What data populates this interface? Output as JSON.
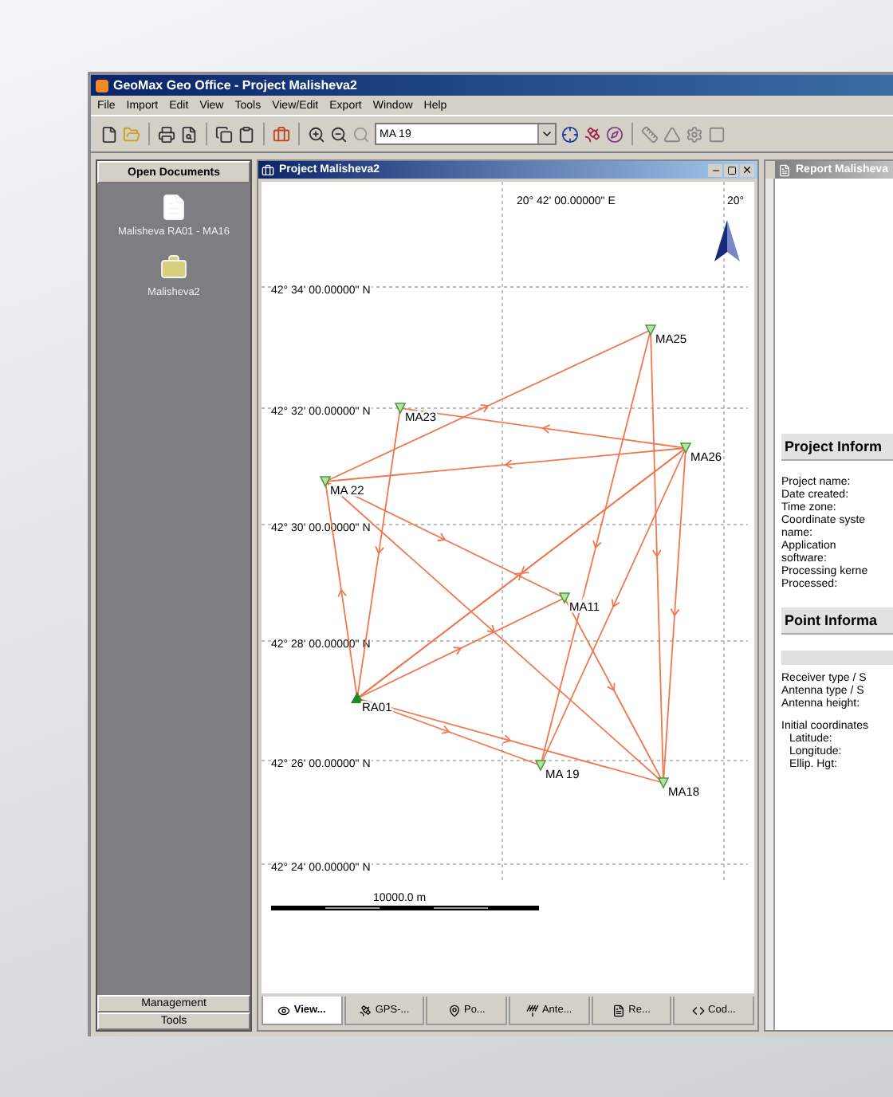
{
  "window": {
    "title": "GeoMax Geo Office - Project Malisheva2"
  },
  "menu": [
    "File",
    "Import",
    "Edit",
    "View",
    "Tools",
    "View/Edit",
    "Export",
    "Window",
    "Help"
  ],
  "toolbar": {
    "point_combo": "MA 19"
  },
  "sidebar": {
    "header": "Open Documents",
    "items": [
      {
        "label": "Malisheva RA01 - MA16",
        "kind": "report"
      },
      {
        "label": "Malisheva2",
        "kind": "project"
      }
    ],
    "footer": [
      "Management",
      "Tools"
    ]
  },
  "map_window": {
    "title": "Project Malisheva2",
    "lon_labels": [
      "20° 42' 00.00000\" E",
      "20°"
    ],
    "lat_labels": [
      "42° 34' 00.00000\" N",
      "42° 32' 00.00000\" N",
      "42° 30' 00.00000\" N",
      "42° 28' 00.00000\" N",
      "42° 26' 00.00000\" N",
      "42° 24' 00.00000\" N"
    ],
    "stations": [
      {
        "name": "MA25",
        "kind": "point"
      },
      {
        "name": "MA23",
        "kind": "point"
      },
      {
        "name": "MA26",
        "kind": "point"
      },
      {
        "name": "MA 22",
        "kind": "point"
      },
      {
        "name": "MA11",
        "kind": "point"
      },
      {
        "name": "RA01",
        "kind": "reference"
      },
      {
        "name": "MA 19",
        "kind": "point"
      },
      {
        "name": "MA18",
        "kind": "point"
      }
    ],
    "scale": "10000.0 m",
    "tabs": [
      {
        "label": "View...",
        "selected": true
      },
      {
        "label": "GPS-...",
        "selected": false
      },
      {
        "label": "Po...",
        "selected": false
      },
      {
        "label": "Ante...",
        "selected": false
      },
      {
        "label": "Re...",
        "selected": false
      },
      {
        "label": "Cod...",
        "selected": false
      }
    ]
  },
  "report_window": {
    "title": "Report Malisheva",
    "sections": [
      {
        "heading": "Project Inform",
        "sub_bar": false,
        "rows": [
          {
            "lines": [
              "Project name:"
            ]
          },
          {
            "lines": [
              "Date created:"
            ]
          },
          {
            "lines": [
              "Time zone:"
            ]
          },
          {
            "lines": [
              "Coordinate syste",
              "name:"
            ]
          },
          {
            "lines": [
              "Application",
              "software:"
            ]
          },
          {
            "lines": [
              "Processing kerne"
            ]
          },
          {
            "lines": [
              "Processed:"
            ]
          }
        ]
      },
      {
        "heading": "Point Informa",
        "sub_bar": true,
        "rows": [
          {
            "lines": [
              "Receiver type / S"
            ]
          },
          {
            "lines": [
              "Antenna type / S"
            ]
          },
          {
            "lines": [
              "Antenna height:"
            ]
          },
          {
            "lines": [
              "Initial coordinates"
            ],
            "children": [
              {
                "lines": [
                  "Latitude:"
                ]
              },
              {
                "lines": [
                  "Longitude:"
                ]
              },
              {
                "lines": [
                  "Ellip. Hgt:"
                ]
              }
            ]
          }
        ]
      }
    ]
  }
}
